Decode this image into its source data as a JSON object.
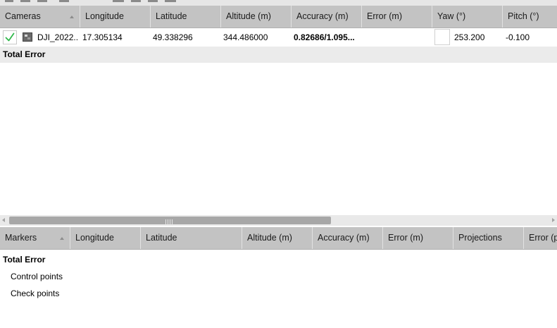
{
  "cameras_table": {
    "headers": [
      "Cameras",
      "Longitude",
      "Latitude",
      "Altitude (m)",
      "Accuracy (m)",
      "Error (m)",
      "Yaw (°)",
      "Pitch (°)"
    ],
    "sort_indicator": "ascending",
    "rows": [
      {
        "checked": true,
        "label": "DJI_2022...",
        "longitude": "17.305134",
        "latitude": "49.338296",
        "altitude": "344.486000",
        "accuracy": "0.82686/1.095...",
        "error": "",
        "yaw": "253.200",
        "pitch": "-0.100"
      }
    ],
    "total_label": "Total Error",
    "scroll_position": 0.02
  },
  "markers_table": {
    "headers": [
      "Markers",
      "Longitude",
      "Latitude",
      "Altitude (m)",
      "Accuracy (m)",
      "Error (m)",
      "Projections",
      "Error (p"
    ],
    "total_label": "Total Error",
    "groups": [
      "Control points",
      "Check points"
    ]
  },
  "colors": {
    "header_bg": "#c3c3c3",
    "total_row_bg": "#ebebeb",
    "checkmark": "#2fb84a",
    "scroll_thumb": "#a7a7a7"
  }
}
